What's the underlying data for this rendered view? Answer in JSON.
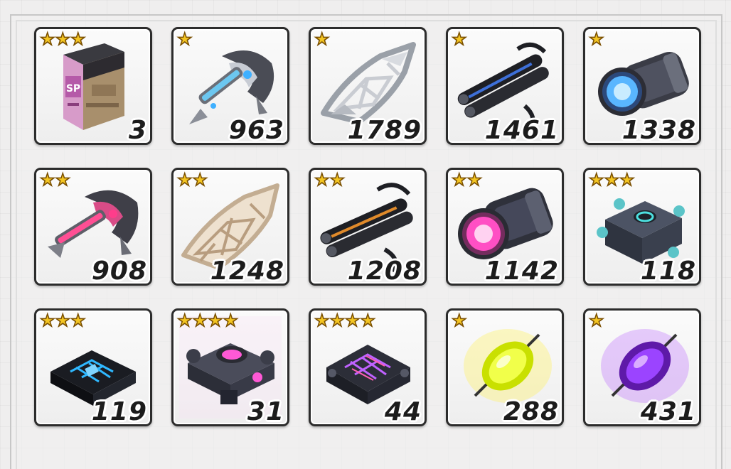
{
  "colors": {
    "star": "#f3c522",
    "frame": "#2c2c2c",
    "count_text": "#1c1c1c"
  },
  "items": [
    {
      "name": "sp-supply-box",
      "icon": "sp-box-icon",
      "rarity": 3,
      "count": "3"
    },
    {
      "name": "blue-ray-claw",
      "icon": "claw-blue-icon",
      "rarity": 1,
      "count": "963"
    },
    {
      "name": "silver-wing-frame",
      "icon": "wing-frame-silver-icon",
      "rarity": 1,
      "count": "1789"
    },
    {
      "name": "blue-cable-bundle",
      "icon": "cable-bundle-blue-icon",
      "rarity": 1,
      "count": "1461"
    },
    {
      "name": "blue-lens-core",
      "icon": "lens-core-blue-icon",
      "rarity": 1,
      "count": "1338"
    },
    {
      "name": "pink-ray-claw",
      "icon": "claw-pink-icon",
      "rarity": 2,
      "count": "908"
    },
    {
      "name": "beige-wing-frame",
      "icon": "wing-frame-beige-icon",
      "rarity": 2,
      "count": "1248"
    },
    {
      "name": "orange-cable-bundle",
      "icon": "cable-bundle-orange-icon",
      "rarity": 2,
      "count": "1208"
    },
    {
      "name": "pink-lens-core",
      "icon": "lens-core-pink-icon",
      "rarity": 2,
      "count": "1142"
    },
    {
      "name": "teal-engine-block",
      "icon": "engine-block-teal-icon",
      "rarity": 3,
      "count": "118"
    },
    {
      "name": "blue-circuit-chip",
      "icon": "circuit-chip-blue-icon",
      "rarity": 3,
      "count": "119"
    },
    {
      "name": "pink-drone-core",
      "icon": "drone-core-pink-icon",
      "rarity": 4,
      "count": "31"
    },
    {
      "name": "purple-circuit-chip",
      "icon": "circuit-chip-purple-icon",
      "rarity": 4,
      "count": "44"
    },
    {
      "name": "yellow-energy-crystal",
      "icon": "crystal-yellow-icon",
      "rarity": 1,
      "count": "288"
    },
    {
      "name": "purple-energy-crystal",
      "icon": "crystal-purple-icon",
      "rarity": 1,
      "count": "431"
    }
  ]
}
